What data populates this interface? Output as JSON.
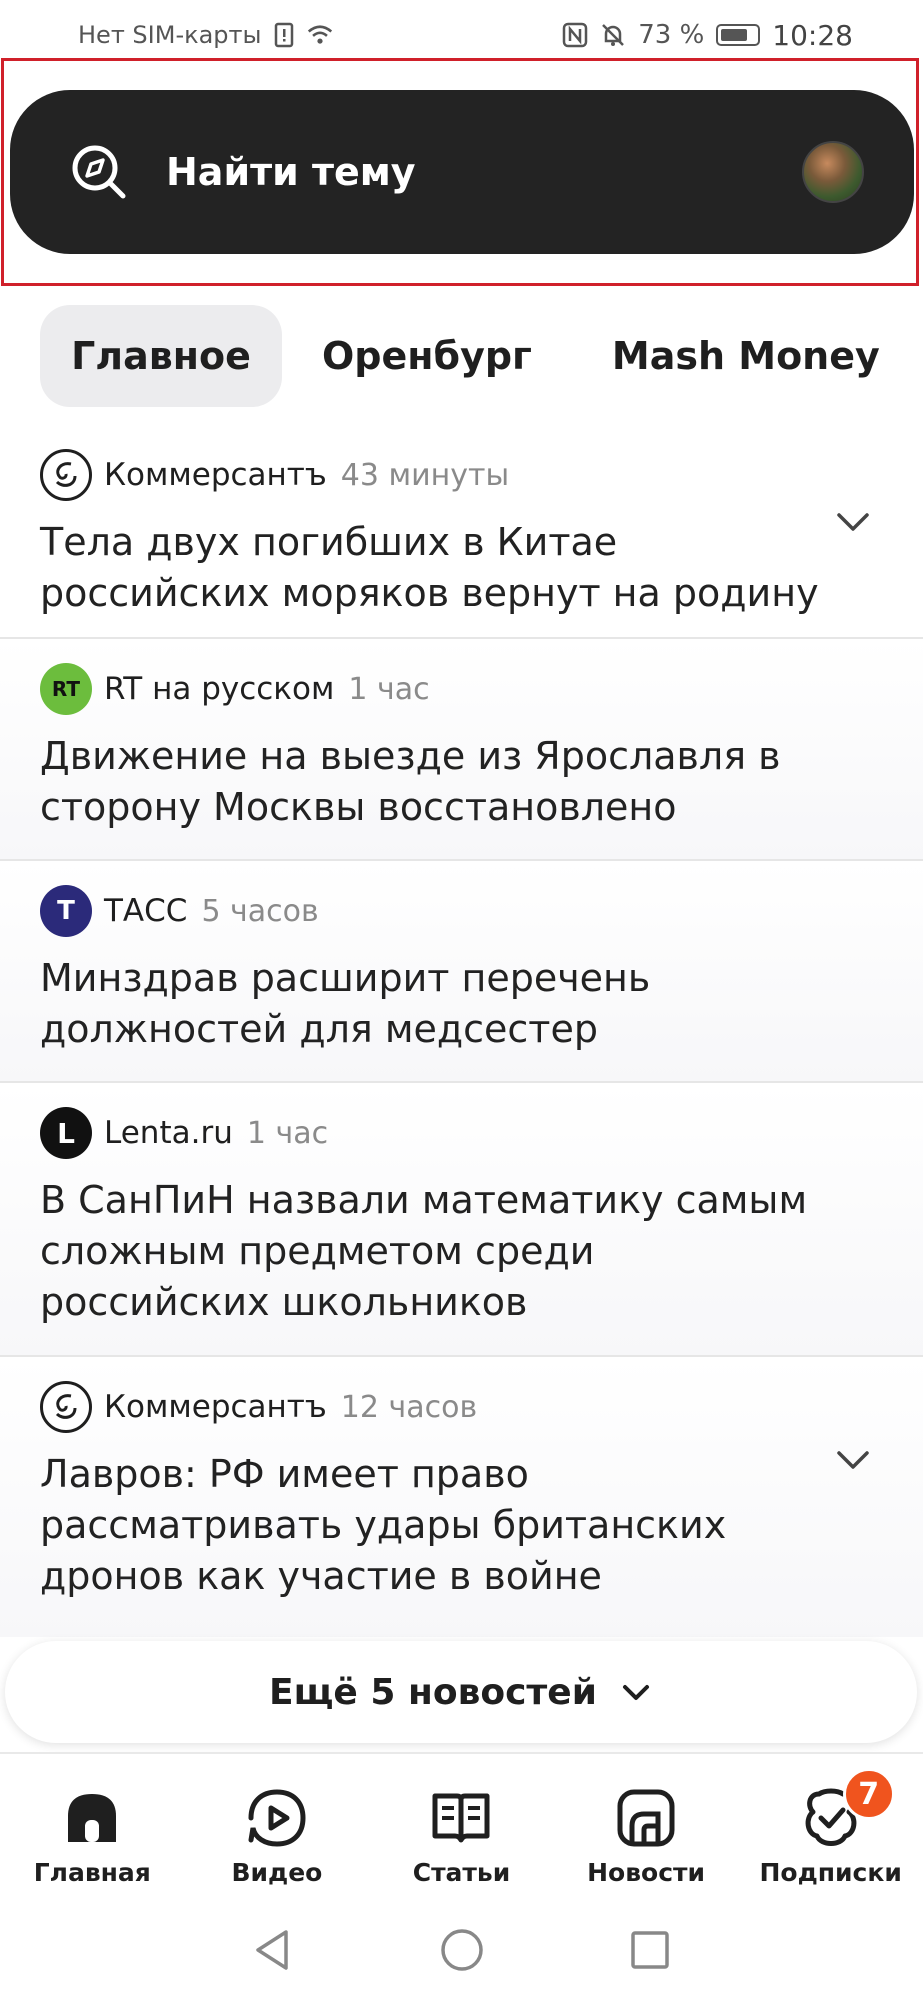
{
  "status_bar": {
    "carrier": "Нет SIM-карты",
    "battery": "73 %",
    "time": "10:28"
  },
  "search": {
    "label": "Найти тему"
  },
  "tabs": [
    {
      "label": "Главное",
      "active": true
    },
    {
      "label": "Оренбург",
      "active": false
    },
    {
      "label": "Mash Money",
      "active": false
    }
  ],
  "news": [
    {
      "source": "Коммерсантъ",
      "time": "43 минуты",
      "headline": "Тела двух погибших в Китае российских моряков вернут на родину",
      "expandable": true
    },
    {
      "source": "RT на русском",
      "time": "1 час",
      "headline": "Движение на выезде из Ярославля в сторону Москвы восстановлено",
      "expandable": false
    },
    {
      "source": "ТАСС",
      "time": "5 часов",
      "headline": "Минздрав расширит перечень должностей для медсестер",
      "expandable": false
    },
    {
      "source": "Lenta.ru",
      "time": "1 час",
      "headline": "В СанПиН назвали математику самым сложным предметом среди российских школьников",
      "expandable": false
    },
    {
      "source": "Коммерсантъ",
      "time": "12 часов",
      "headline": "Лавров: РФ имеет право рассматривать удары британских дронов как участие в войне",
      "expandable": true
    }
  ],
  "logos": {
    "rt": "RT",
    "tass": "T",
    "lenta": "L"
  },
  "more_button": {
    "label": "Ещё 5 новостей"
  },
  "bottom_nav": [
    {
      "label": "Главная",
      "icon": "home-icon"
    },
    {
      "label": "Видео",
      "icon": "video-icon"
    },
    {
      "label": "Статьи",
      "icon": "articles-icon"
    },
    {
      "label": "Новости",
      "icon": "news-icon"
    },
    {
      "label": "Подписки",
      "icon": "subscriptions-icon",
      "badge": "7"
    }
  ],
  "colors": {
    "search_bg": "#232323",
    "badge": "#f0541e",
    "tass": "#2b2a7a",
    "rt": "#6cbd3d"
  }
}
